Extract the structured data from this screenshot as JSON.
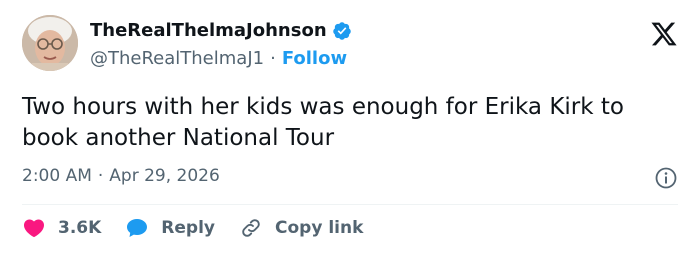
{
  "author": {
    "display_name": "TheRealThelmaJohnson",
    "handle": "@TheRealThelmaJ1",
    "separator": "·",
    "follow_label": "Follow"
  },
  "tweet": {
    "text": "Two hours with her kids was enough for Erika Kirk to book another National Tour"
  },
  "meta": {
    "time": "2:00 AM",
    "separator": "·",
    "date": "Apr 29, 2026"
  },
  "actions": {
    "like_count": "3.6K",
    "reply_label": "Reply",
    "copy_label": "Copy link"
  },
  "icons": {
    "verified": "verified-badge-icon",
    "brand": "x-logo-icon",
    "info": "info-icon",
    "like": "heart-icon",
    "reply": "speech-bubble-icon",
    "copy": "link-icon"
  },
  "colors": {
    "accent": "#1d9bf0",
    "like": "#f91880",
    "text": "#0f1419",
    "muted": "#536471"
  }
}
